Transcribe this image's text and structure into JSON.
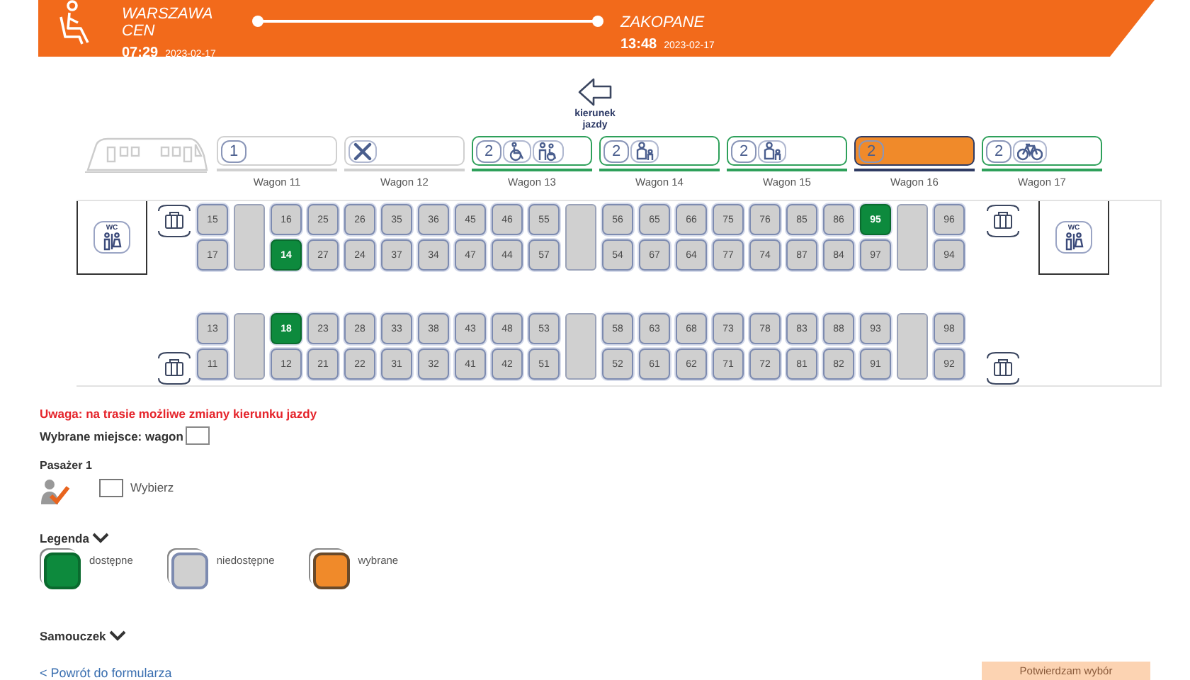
{
  "header": {
    "from": {
      "station": "WARSZAWA CEN",
      "time": "07:29",
      "date": "2023-02-17"
    },
    "to": {
      "station": "ZAKOPANE",
      "time": "13:48",
      "date": "2023-02-17"
    }
  },
  "direction": {
    "label": "kierunek jazdy"
  },
  "wagons": [
    {
      "kind": "locomotive"
    },
    {
      "kind": "wagon",
      "label": "Wagon 11",
      "class": "1",
      "available": false,
      "selected": false
    },
    {
      "kind": "wagon",
      "label": "Wagon 12",
      "available": false,
      "selected": false,
      "amenities": [
        {
          "kind": "restaurant"
        }
      ]
    },
    {
      "kind": "wagon",
      "label": "Wagon 13",
      "class": "2",
      "available": true,
      "selected": false,
      "amenities": [
        {
          "kind": "wheelchair"
        },
        {
          "kind": "companion"
        }
      ]
    },
    {
      "kind": "wagon",
      "label": "Wagon 14",
      "class": "2",
      "available": true,
      "selected": false,
      "amenities": [
        {
          "kind": "child"
        }
      ]
    },
    {
      "kind": "wagon",
      "label": "Wagon 15",
      "class": "2",
      "available": true,
      "selected": false,
      "amenities": [
        {
          "kind": "child"
        }
      ]
    },
    {
      "kind": "wagon",
      "label": "Wagon 16",
      "class": "2",
      "available": true,
      "selected": true
    },
    {
      "kind": "wagon",
      "label": "Wagon 17",
      "class": "2",
      "available": true,
      "selected": false,
      "amenities": [
        {
          "kind": "bicycle"
        }
      ]
    }
  ],
  "seat_map": {
    "blocks": [
      {
        "columns": [
          {
            "kind": "seats",
            "seats": [
              {
                "number": "15",
                "available": false,
                "selected": false
              },
              {
                "number": "17",
                "available": false,
                "selected": false
              }
            ]
          },
          {
            "kind": "table"
          },
          {
            "kind": "seats",
            "seats": [
              {
                "number": "16",
                "available": false,
                "selected": false
              },
              {
                "number": "14",
                "available": true,
                "selected": false
              }
            ]
          },
          {
            "kind": "seats",
            "seats": [
              {
                "number": "25",
                "available": false,
                "selected": false
              },
              {
                "number": "27",
                "available": false,
                "selected": false
              }
            ]
          },
          {
            "kind": "seats",
            "seats": [
              {
                "number": "26",
                "available": false,
                "selected": false
              },
              {
                "number": "24",
                "available": false,
                "selected": false
              }
            ]
          },
          {
            "kind": "seats",
            "seats": [
              {
                "number": "35",
                "available": false,
                "selected": false
              },
              {
                "number": "37",
                "available": false,
                "selected": false
              }
            ]
          },
          {
            "kind": "seats",
            "seats": [
              {
                "number": "36",
                "available": false,
                "selected": false
              },
              {
                "number": "34",
                "available": false,
                "selected": false
              }
            ]
          },
          {
            "kind": "seats",
            "seats": [
              {
                "number": "45",
                "available": false,
                "selected": false
              },
              {
                "number": "47",
                "available": false,
                "selected": false
              }
            ]
          },
          {
            "kind": "seats",
            "seats": [
              {
                "number": "46",
                "available": false,
                "selected": false
              },
              {
                "number": "44",
                "available": false,
                "selected": false
              }
            ]
          },
          {
            "kind": "seats",
            "seats": [
              {
                "number": "55",
                "available": false,
                "selected": false
              },
              {
                "number": "57",
                "available": false,
                "selected": false
              }
            ]
          },
          {
            "kind": "table"
          },
          {
            "kind": "seats",
            "seats": [
              {
                "number": "56",
                "available": false,
                "selected": false
              },
              {
                "number": "54",
                "available": false,
                "selected": false
              }
            ]
          },
          {
            "kind": "seats",
            "seats": [
              {
                "number": "65",
                "available": false,
                "selected": false
              },
              {
                "number": "67",
                "available": false,
                "selected": false
              }
            ]
          },
          {
            "kind": "seats",
            "seats": [
              {
                "number": "66",
                "available": false,
                "selected": false
              },
              {
                "number": "64",
                "available": false,
                "selected": false
              }
            ]
          },
          {
            "kind": "seats",
            "seats": [
              {
                "number": "75",
                "available": false,
                "selected": false
              },
              {
                "number": "77",
                "available": false,
                "selected": false
              }
            ]
          },
          {
            "kind": "seats",
            "seats": [
              {
                "number": "76",
                "available": false,
                "selected": false
              },
              {
                "number": "74",
                "available": false,
                "selected": false
              }
            ]
          },
          {
            "kind": "seats",
            "seats": [
              {
                "number": "85",
                "available": false,
                "selected": false
              },
              {
                "number": "87",
                "available": false,
                "selected": false
              }
            ]
          },
          {
            "kind": "seats",
            "seats": [
              {
                "number": "86",
                "available": false,
                "selected": false
              },
              {
                "number": "84",
                "available": false,
                "selected": false
              }
            ]
          },
          {
            "kind": "seats",
            "seats": [
              {
                "number": "95",
                "available": true,
                "selected": false
              },
              {
                "number": "97",
                "available": false,
                "selected": false
              }
            ]
          },
          {
            "kind": "table"
          },
          {
            "kind": "seats",
            "seats": [
              {
                "number": "96",
                "available": false,
                "selected": false
              },
              {
                "number": "94",
                "available": false,
                "selected": false
              }
            ]
          }
        ]
      },
      {
        "columns": [
          {
            "kind": "seats",
            "seats": [
              {
                "number": "13",
                "available": false,
                "selected": false
              },
              {
                "number": "11",
                "available": false,
                "selected": false
              }
            ]
          },
          {
            "kind": "table"
          },
          {
            "kind": "seats",
            "seats": [
              {
                "number": "18",
                "available": true,
                "selected": false
              },
              {
                "number": "12",
                "available": false,
                "selected": false
              }
            ]
          },
          {
            "kind": "seats",
            "seats": [
              {
                "number": "23",
                "available": false,
                "selected": false
              },
              {
                "number": "21",
                "available": false,
                "selected": false
              }
            ]
          },
          {
            "kind": "seats",
            "seats": [
              {
                "number": "28",
                "available": false,
                "selected": false
              },
              {
                "number": "22",
                "available": false,
                "selected": false
              }
            ]
          },
          {
            "kind": "seats",
            "seats": [
              {
                "number": "33",
                "available": false,
                "selected": false
              },
              {
                "number": "31",
                "available": false,
                "selected": false
              }
            ]
          },
          {
            "kind": "seats",
            "seats": [
              {
                "number": "38",
                "available": false,
                "selected": false
              },
              {
                "number": "32",
                "available": false,
                "selected": false
              }
            ]
          },
          {
            "kind": "seats",
            "seats": [
              {
                "number": "43",
                "available": false,
                "selected": false
              },
              {
                "number": "41",
                "available": false,
                "selected": false
              }
            ]
          },
          {
            "kind": "seats",
            "seats": [
              {
                "number": "48",
                "available": false,
                "selected": false
              },
              {
                "number": "42",
                "available": false,
                "selected": false
              }
            ]
          },
          {
            "kind": "seats",
            "seats": [
              {
                "number": "53",
                "available": false,
                "selected": false
              },
              {
                "number": "51",
                "available": false,
                "selected": false
              }
            ]
          },
          {
            "kind": "table"
          },
          {
            "kind": "seats",
            "seats": [
              {
                "number": "58",
                "available": false,
                "selected": false
              },
              {
                "number": "52",
                "available": false,
                "selected": false
              }
            ]
          },
          {
            "kind": "seats",
            "seats": [
              {
                "number": "63",
                "available": false,
                "selected": false
              },
              {
                "number": "61",
                "available": false,
                "selected": false
              }
            ]
          },
          {
            "kind": "seats",
            "seats": [
              {
                "number": "68",
                "available": false,
                "selected": false
              },
              {
                "number": "62",
                "available": false,
                "selected": false
              }
            ]
          },
          {
            "kind": "seats",
            "seats": [
              {
                "number": "73",
                "available": false,
                "selected": false
              },
              {
                "number": "71",
                "available": false,
                "selected": false
              }
            ]
          },
          {
            "kind": "seats",
            "seats": [
              {
                "number": "78",
                "available": false,
                "selected": false
              },
              {
                "number": "72",
                "available": false,
                "selected": false
              }
            ]
          },
          {
            "kind": "seats",
            "seats": [
              {
                "number": "83",
                "available": false,
                "selected": false
              },
              {
                "number": "81",
                "available": false,
                "selected": false
              }
            ]
          },
          {
            "kind": "seats",
            "seats": [
              {
                "number": "88",
                "available": false,
                "selected": false
              },
              {
                "number": "82",
                "available": false,
                "selected": false
              }
            ]
          },
          {
            "kind": "seats",
            "seats": [
              {
                "number": "93",
                "available": false,
                "selected": false
              },
              {
                "number": "91",
                "available": false,
                "selected": false
              }
            ]
          },
          {
            "kind": "table"
          },
          {
            "kind": "seats",
            "seats": [
              {
                "number": "98",
                "available": false,
                "selected": false
              },
              {
                "number": "92",
                "available": false,
                "selected": false
              }
            ]
          }
        ]
      }
    ],
    "toilets": [
      {
        "label": "WC"
      },
      {
        "label": "WC"
      }
    ]
  },
  "warning": "Uwaga: na trasie możliwe zmiany kierunku jazdy",
  "chosen_seat": {
    "label": "Wybrane miejsce: wagon"
  },
  "passenger": {
    "title": "Pasażer 1",
    "choose": {
      "label": "Wybierz",
      "checked": false
    }
  },
  "legend": {
    "title": "Legenda",
    "items": [
      {
        "kind": "available",
        "label": "dostępne"
      },
      {
        "kind": "unavailable",
        "label": "niedostępne"
      },
      {
        "kind": "selected",
        "label": "wybrane"
      }
    ]
  },
  "tutorial": {
    "title": "Samouczek"
  },
  "back_link": "< Powrót do formularza",
  "confirm_button": {
    "label": "Potwierdzam wybór",
    "disabled": true
  }
}
